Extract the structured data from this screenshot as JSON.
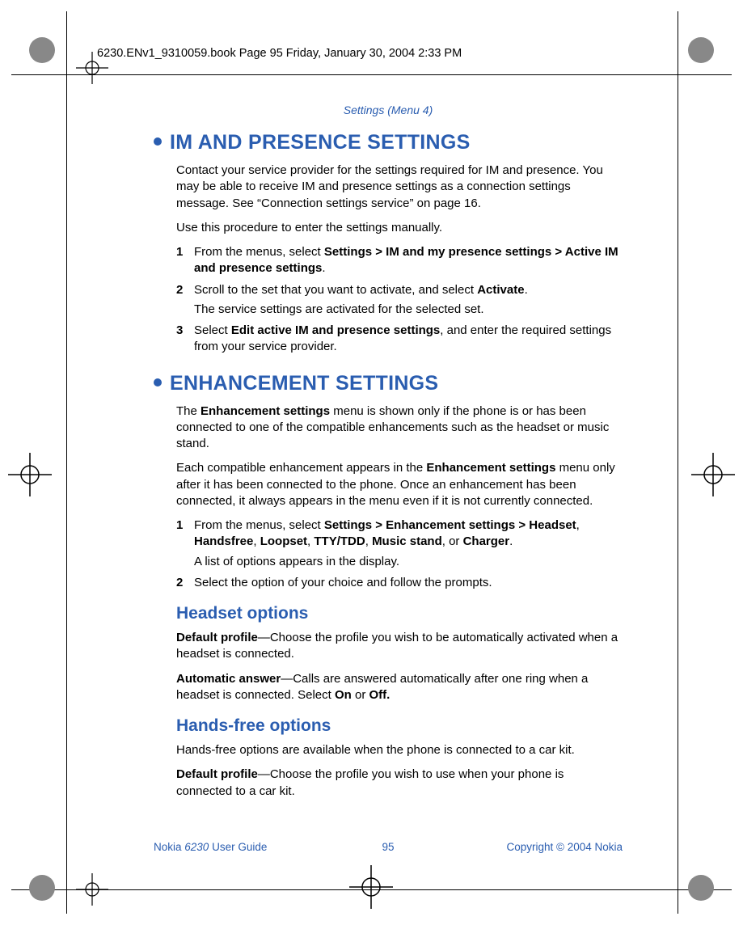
{
  "header": "6230.ENv1_9310059.book  Page 95  Friday, January 30, 2004  2:33 PM",
  "breadcrumb": "Settings (Menu 4)",
  "sections": {
    "im": {
      "title": "IM AND PRESENCE SETTINGS",
      "p1": "Contact your service provider for the settings required for IM and presence. You may be able to receive IM and presence settings as a connection settings message. See “Connection settings service” on page 16.",
      "p2": "Use this procedure to enter the settings manually.",
      "steps": {
        "s1a": "From the menus, select ",
        "s1b": "Settings > IM and my presence settings > Active IM and presence settings",
        "s1c": ".",
        "s2a": "Scroll to the set that you want to activate, and select ",
        "s2b": "Activate",
        "s2c": ".",
        "s2sub": "The service settings are activated for the selected set.",
        "s3a": "Select ",
        "s3b": "Edit active IM and presence settings",
        "s3c": ", and enter the required settings from your service provider."
      }
    },
    "enh": {
      "title": "ENHANCEMENT SETTINGS",
      "p1a": "The ",
      "p1b": "Enhancement settings",
      "p1c": " menu is shown only if the phone is or has been connected to one of the compatible enhancements such as the headset or music stand.",
      "p2a": "Each compatible enhancement appears in the ",
      "p2b": "Enhancement settings",
      "p2c": " menu only after it has been connected to the phone. Once an enhancement has been connected, it always appears in the menu even if it is not currently connected.",
      "steps": {
        "s1a": "From the menus, select ",
        "s1b": "Settings > Enhancement settings > Headset",
        "s1c": ", ",
        "s1d": "Handsfree",
        "s1e": ", ",
        "s1f": "Loopset",
        "s1g": ", ",
        "s1h": "TTY/TDD",
        "s1i": ", ",
        "s1j": "Music stand",
        "s1k": ", or ",
        "s1l": "Charger",
        "s1m": ".",
        "s1sub": "A list of options appears in the display.",
        "s2": "Select the option of your choice and follow the prompts."
      }
    },
    "headset": {
      "title": "Headset options",
      "p1a": "Default profile",
      "p1b": "—Choose the profile you wish to be automatically activated when a headset is connected.",
      "p2a": "Automatic answer",
      "p2b": "—Calls are answered automatically after one ring when a headset is connected. Select ",
      "p2c": "On",
      "p2d": " or ",
      "p2e": "Off."
    },
    "handsfree": {
      "title": "Hands-free options",
      "p1": "Hands-free options are available when the phone is connected to a car kit.",
      "p2a": "Default profile",
      "p2b": "—Choose the profile you wish to use when your phone is connected to a car kit."
    }
  },
  "footer": {
    "left_pre": "Nokia ",
    "left_model": "6230",
    "left_post": " User Guide",
    "page": "95",
    "right": "Copyright © 2004 Nokia"
  }
}
